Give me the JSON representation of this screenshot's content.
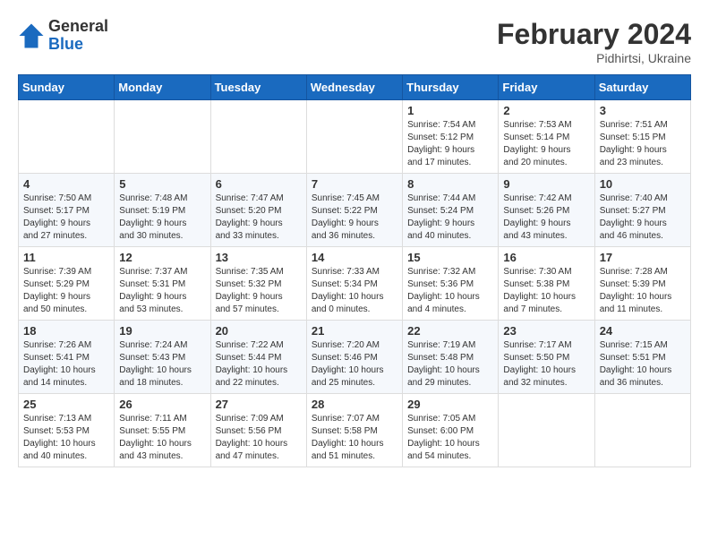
{
  "header": {
    "logo_general": "General",
    "logo_blue": "Blue",
    "month_year": "February 2024",
    "location": "Pidhirtsi, Ukraine"
  },
  "weekdays": [
    "Sunday",
    "Monday",
    "Tuesday",
    "Wednesday",
    "Thursday",
    "Friday",
    "Saturday"
  ],
  "weeks": [
    [
      {
        "day": "",
        "info": ""
      },
      {
        "day": "",
        "info": ""
      },
      {
        "day": "",
        "info": ""
      },
      {
        "day": "",
        "info": ""
      },
      {
        "day": "1",
        "info": "Sunrise: 7:54 AM\nSunset: 5:12 PM\nDaylight: 9 hours\nand 17 minutes."
      },
      {
        "day": "2",
        "info": "Sunrise: 7:53 AM\nSunset: 5:14 PM\nDaylight: 9 hours\nand 20 minutes."
      },
      {
        "day": "3",
        "info": "Sunrise: 7:51 AM\nSunset: 5:15 PM\nDaylight: 9 hours\nand 23 minutes."
      }
    ],
    [
      {
        "day": "4",
        "info": "Sunrise: 7:50 AM\nSunset: 5:17 PM\nDaylight: 9 hours\nand 27 minutes."
      },
      {
        "day": "5",
        "info": "Sunrise: 7:48 AM\nSunset: 5:19 PM\nDaylight: 9 hours\nand 30 minutes."
      },
      {
        "day": "6",
        "info": "Sunrise: 7:47 AM\nSunset: 5:20 PM\nDaylight: 9 hours\nand 33 minutes."
      },
      {
        "day": "7",
        "info": "Sunrise: 7:45 AM\nSunset: 5:22 PM\nDaylight: 9 hours\nand 36 minutes."
      },
      {
        "day": "8",
        "info": "Sunrise: 7:44 AM\nSunset: 5:24 PM\nDaylight: 9 hours\nand 40 minutes."
      },
      {
        "day": "9",
        "info": "Sunrise: 7:42 AM\nSunset: 5:26 PM\nDaylight: 9 hours\nand 43 minutes."
      },
      {
        "day": "10",
        "info": "Sunrise: 7:40 AM\nSunset: 5:27 PM\nDaylight: 9 hours\nand 46 minutes."
      }
    ],
    [
      {
        "day": "11",
        "info": "Sunrise: 7:39 AM\nSunset: 5:29 PM\nDaylight: 9 hours\nand 50 minutes."
      },
      {
        "day": "12",
        "info": "Sunrise: 7:37 AM\nSunset: 5:31 PM\nDaylight: 9 hours\nand 53 minutes."
      },
      {
        "day": "13",
        "info": "Sunrise: 7:35 AM\nSunset: 5:32 PM\nDaylight: 9 hours\nand 57 minutes."
      },
      {
        "day": "14",
        "info": "Sunrise: 7:33 AM\nSunset: 5:34 PM\nDaylight: 10 hours\nand 0 minutes."
      },
      {
        "day": "15",
        "info": "Sunrise: 7:32 AM\nSunset: 5:36 PM\nDaylight: 10 hours\nand 4 minutes."
      },
      {
        "day": "16",
        "info": "Sunrise: 7:30 AM\nSunset: 5:38 PM\nDaylight: 10 hours\nand 7 minutes."
      },
      {
        "day": "17",
        "info": "Sunrise: 7:28 AM\nSunset: 5:39 PM\nDaylight: 10 hours\nand 11 minutes."
      }
    ],
    [
      {
        "day": "18",
        "info": "Sunrise: 7:26 AM\nSunset: 5:41 PM\nDaylight: 10 hours\nand 14 minutes."
      },
      {
        "day": "19",
        "info": "Sunrise: 7:24 AM\nSunset: 5:43 PM\nDaylight: 10 hours\nand 18 minutes."
      },
      {
        "day": "20",
        "info": "Sunrise: 7:22 AM\nSunset: 5:44 PM\nDaylight: 10 hours\nand 22 minutes."
      },
      {
        "day": "21",
        "info": "Sunrise: 7:20 AM\nSunset: 5:46 PM\nDaylight: 10 hours\nand 25 minutes."
      },
      {
        "day": "22",
        "info": "Sunrise: 7:19 AM\nSunset: 5:48 PM\nDaylight: 10 hours\nand 29 minutes."
      },
      {
        "day": "23",
        "info": "Sunrise: 7:17 AM\nSunset: 5:50 PM\nDaylight: 10 hours\nand 32 minutes."
      },
      {
        "day": "24",
        "info": "Sunrise: 7:15 AM\nSunset: 5:51 PM\nDaylight: 10 hours\nand 36 minutes."
      }
    ],
    [
      {
        "day": "25",
        "info": "Sunrise: 7:13 AM\nSunset: 5:53 PM\nDaylight: 10 hours\nand 40 minutes."
      },
      {
        "day": "26",
        "info": "Sunrise: 7:11 AM\nSunset: 5:55 PM\nDaylight: 10 hours\nand 43 minutes."
      },
      {
        "day": "27",
        "info": "Sunrise: 7:09 AM\nSunset: 5:56 PM\nDaylight: 10 hours\nand 47 minutes."
      },
      {
        "day": "28",
        "info": "Sunrise: 7:07 AM\nSunset: 5:58 PM\nDaylight: 10 hours\nand 51 minutes."
      },
      {
        "day": "29",
        "info": "Sunrise: 7:05 AM\nSunset: 6:00 PM\nDaylight: 10 hours\nand 54 minutes."
      },
      {
        "day": "",
        "info": ""
      },
      {
        "day": "",
        "info": ""
      }
    ]
  ]
}
